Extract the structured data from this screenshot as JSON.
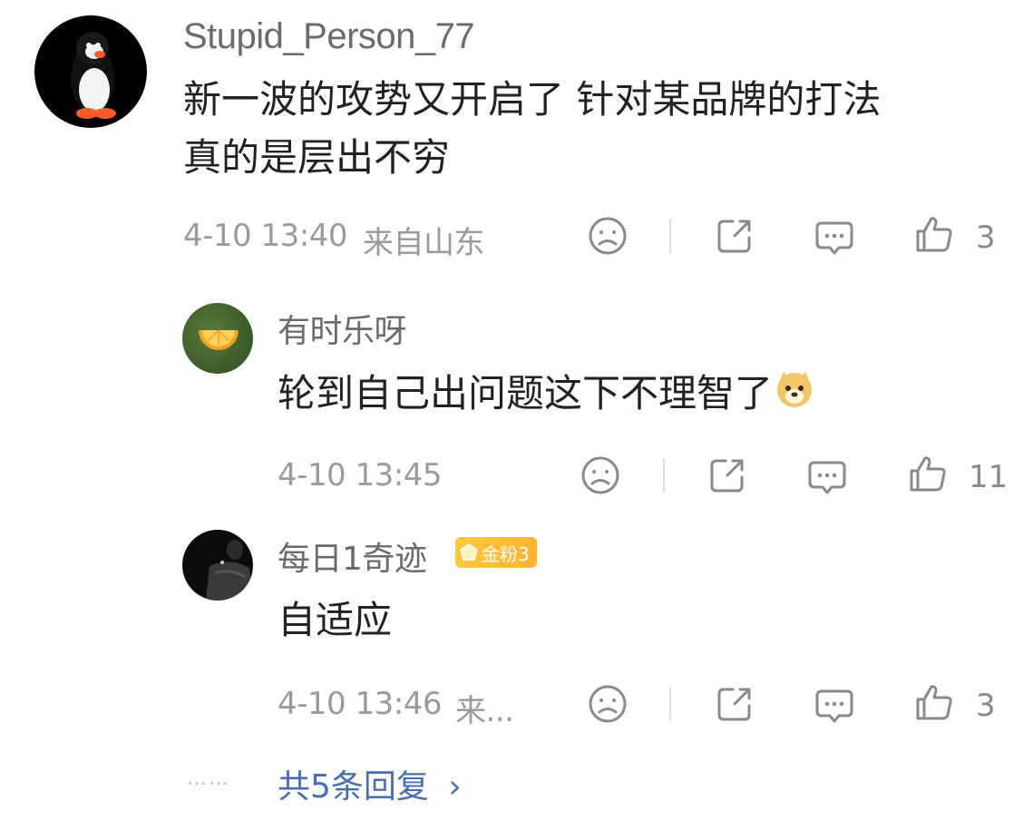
{
  "comment": {
    "username": "Stupid_Person_77",
    "text_line1": "新一波的攻势又开启了 针对某品牌的打法",
    "text_line2": "真的是层出不穷",
    "time": "4-10 13:40",
    "location": "来自山东",
    "likes": "3"
  },
  "replies": [
    {
      "username": "有时乐呀",
      "text": "轮到自己出问题这下不理智了",
      "emoji": "doge-emoji",
      "time": "4-10 13:45",
      "likes": "11"
    },
    {
      "username": "每日1奇迹",
      "badge": "金粉3",
      "text": "自适应",
      "time": "4-10 13:46",
      "location_truncated": "来...",
      "likes": "3"
    }
  ],
  "footer": {
    "dots": "……",
    "more_replies": "共5条回复",
    "chevron": "›"
  },
  "icons": [
    "dislike-icon",
    "share-icon",
    "comment-icon",
    "like-icon"
  ],
  "colors": {
    "link": "#4a6fb0",
    "badge": "#ffb52e",
    "meta": "#9a9a9a"
  }
}
